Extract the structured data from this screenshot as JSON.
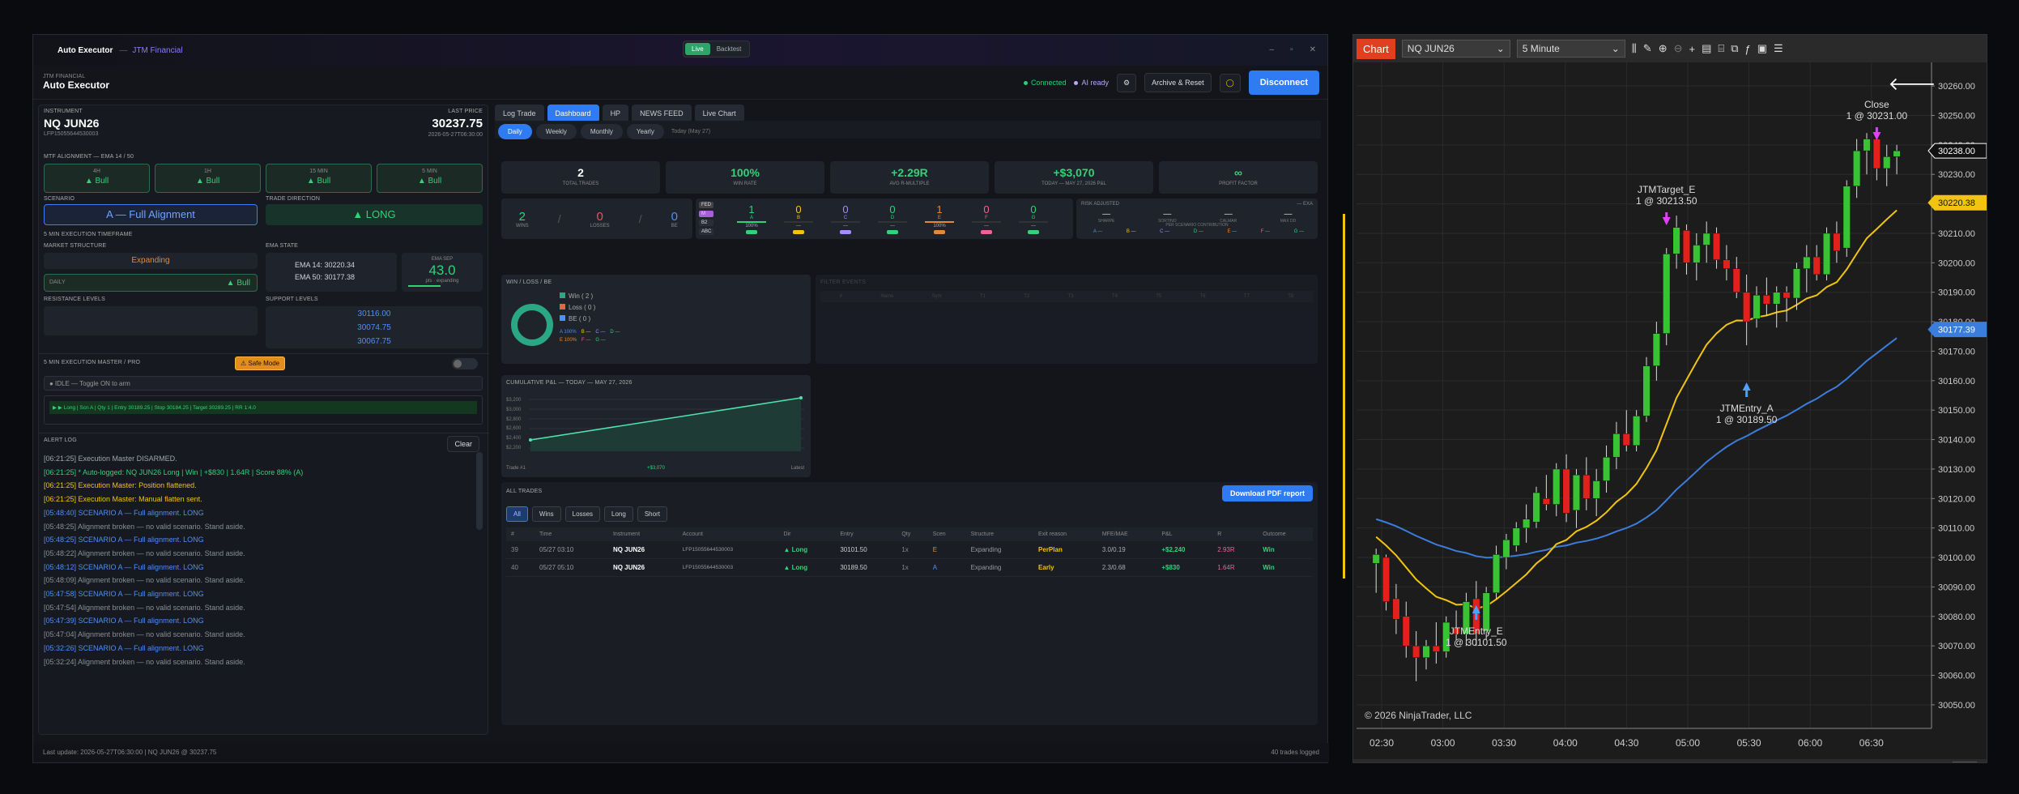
{
  "app": {
    "title": "Auto Executor",
    "separator": "—",
    "subtitle": "JTM Financial",
    "mode_live": "Live",
    "mode_backtest": "Backtest",
    "min": "–",
    "max": "▫",
    "close": "✕"
  },
  "header": {
    "company": "JTM FINANCIAL",
    "title": "Auto Executor",
    "connected": "Connected",
    "ai": "AI ready",
    "settings_icon": "⚙",
    "archive": "Archive & Reset",
    "disconnect": "Disconnect"
  },
  "instrument": {
    "label": "INSTRUMENT",
    "name": "NQ JUN26",
    "account": "LFP15055644530003",
    "last_label": "LAST PRICE",
    "last": "30237.75",
    "time": "2026-05-27T06:30:00"
  },
  "mtf": {
    "label": "MTF ALIGNMENT — EMA 14 / 50",
    "tiles": [
      {
        "tf": "4H",
        "v": "▲ Bull"
      },
      {
        "tf": "1H",
        "v": "▲ Bull"
      },
      {
        "tf": "15 MIN",
        "v": "▲ Bull"
      },
      {
        "tf": "5 MIN",
        "v": "▲ Bull"
      }
    ]
  },
  "scenario": {
    "label": "SCENARIO",
    "value": "A — Full Alignment",
    "dir_label": "TRADE DIRECTION",
    "dir": "▲ LONG"
  },
  "exec": {
    "label": "5 MIN EXECUTION TIMEFRAME",
    "ms_label": "MARKET STRUCTURE",
    "ms": "Expanding",
    "daily": "DAILY",
    "daily_v": "▲ Bull",
    "ema_label": "EMA STATE",
    "ema14": "EMA 14:  30220.34",
    "ema50": "EMA 50:  30177.38",
    "sep_label": "EMA SEP",
    "sep": "43.0",
    "sep_sub": "pts · expanding",
    "res_label": "RESISTANCE LEVELS",
    "sup_label": "SUPPORT LEVELS",
    "supports": [
      "30116.00",
      "30074.75",
      "30067.75"
    ]
  },
  "master": {
    "label": "5 MIN EXECUTION MASTER / PRO",
    "safe": "⚠ Safe Mode",
    "idle": "● IDLE — Toggle ON to arm",
    "signal": "▶ ▶ Long | Scn A | Qty 1 | Entry 30189.25 | Stop 30184.25 | Target 30289.25 | RR 1:4.0"
  },
  "alert": {
    "label": "ALERT LOG",
    "clear": "Clear",
    "lines": [
      {
        "t": "[06:21:25]  Execution Master DISARMED.",
        "c": "#a0a4ad"
      },
      {
        "t": "[06:21:25]  * Auto-logged: NQ JUN26 Long | Win | +$830 | 1.64R | Score 88% (A)",
        "c": "#33d17a"
      },
      {
        "t": "[06:21:25]  Execution Master: Position flattened.",
        "c": "#f1c40f"
      },
      {
        "t": "[06:21:25]  Execution Master: Manual flatten sent.",
        "c": "#f1c40f"
      },
      {
        "t": "[05:48:40]  SCENARIO A — Full alignment. LONG",
        "c": "#4f8ff7"
      },
      {
        "t": "[05:48:25]  Alignment broken — no valid scenario. Stand aside.",
        "c": "#8a8e97"
      },
      {
        "t": "[05:48:25]  SCENARIO A — Full alignment. LONG",
        "c": "#4f8ff7"
      },
      {
        "t": "[05:48:22]  Alignment broken — no valid scenario. Stand aside.",
        "c": "#8a8e97"
      },
      {
        "t": "[05:48:12]  SCENARIO A — Full alignment. LONG",
        "c": "#4f8ff7"
      },
      {
        "t": "[05:48:09]  Alignment broken — no valid scenario. Stand aside.",
        "c": "#8a8e97"
      },
      {
        "t": "[05:47:58]  SCENARIO A — Full alignment. LONG",
        "c": "#4f8ff7"
      },
      {
        "t": "[05:47:54]  Alignment broken — no valid scenario. Stand aside.",
        "c": "#8a8e97"
      },
      {
        "t": "[05:47:39]  SCENARIO A — Full alignment. LONG",
        "c": "#4f8ff7"
      },
      {
        "t": "[05:47:04]  Alignment broken — no valid scenario. Stand aside.",
        "c": "#8a8e97"
      },
      {
        "t": "[05:32:26]  SCENARIO A — Full alignment. LONG",
        "c": "#4f8ff7"
      },
      {
        "t": "[05:32:24]  Alignment broken — no valid scenario. Stand aside.",
        "c": "#8a8e97"
      }
    ]
  },
  "footer": {
    "left": "Last update: 2026-05-27T06:30:00 | NQ JUN26 @ 30237.75",
    "right": "40 trades logged"
  },
  "tabs": [
    "Log Trade",
    "Dashboard",
    "HP",
    "NEWS FEED",
    "Live Chart"
  ],
  "periods": [
    "Daily",
    "Weekly",
    "Monthly",
    "Yearly"
  ],
  "period_note": "Today (May 27)",
  "stats": [
    {
      "v": "2",
      "l": "TOTAL TRADES",
      "c": "#ffffff"
    },
    {
      "v": "100%",
      "l": "WIN RATE",
      "c": "#33d17a"
    },
    {
      "v": "+2.29R",
      "l": "AVG R-MULTIPLE",
      "c": "#33d17a"
    },
    {
      "v": "+$3,070",
      "l": "TODAY — MAY 27, 2026 P&L",
      "c": "#33d17a"
    },
    {
      "v": "∞",
      "l": "PROFIT FACTOR",
      "c": "#33d17a"
    }
  ],
  "wlb": [
    {
      "v": "2",
      "l": "WINS",
      "c": "#33d17a"
    },
    {
      "v": "0",
      "l": "LOSSES",
      "c": "#ef5350"
    },
    {
      "v": "0",
      "l": "BE",
      "c": "#4f8ff7"
    }
  ],
  "scen_tags": [
    "FED",
    "M",
    "B2",
    "ABC"
  ],
  "scen": [
    {
      "n": "1",
      "k": "A",
      "p": "100%",
      "c": "#33d17a"
    },
    {
      "n": "0",
      "k": "B",
      "p": "—",
      "c": "#f1c40f"
    },
    {
      "n": "0",
      "k": "C",
      "p": "—",
      "c": "#a58bff"
    },
    {
      "n": "0",
      "k": "D",
      "p": "—",
      "c": "#33d17a"
    },
    {
      "n": "1",
      "k": "E",
      "p": "100%",
      "c": "#e08a3c"
    },
    {
      "n": "0",
      "k": "F",
      "p": "—",
      "c": "#f06292"
    },
    {
      "n": "0",
      "k": "G",
      "p": "—",
      "c": "#33d17a"
    }
  ],
  "risk": {
    "label": "RISK ADJUSTED",
    "tag": "— EXA",
    "items": [
      "SHARPE",
      "SORTINO",
      "CALMAR",
      "MAX DD"
    ],
    "val": "—",
    "sub": "PER SCENARIO CONTRIBUTION",
    "contrib": [
      "A —",
      "B —",
      "C —",
      "D —",
      "E —",
      "F —",
      "G —"
    ]
  },
  "wlbox": {
    "label": "WIN / LOSS / BE",
    "legend": [
      "Win ( 2 )",
      "Loss ( 0 )",
      "BE ( 0 )"
    ],
    "mini": [
      "A 100%",
      "B —",
      "C —",
      "D —",
      "E 100%",
      "F —",
      "G —"
    ]
  },
  "filter": {
    "label": "FILTER EVENTS",
    "cols": [
      "#",
      "Name",
      "Sym",
      "T1",
      "T2",
      "T3",
      "T4",
      "T5",
      "T6",
      "T7",
      "T8"
    ]
  },
  "cum": {
    "label": "CUMULATIVE P&L — TODAY — MAY 27, 2026",
    "y": [
      "$3,200",
      "$3,000",
      "$2,800",
      "$2,600",
      "$2,400",
      "$2,200"
    ],
    "xl": "Trade #1",
    "xm": "+$3,070",
    "xr": "Latest"
  },
  "trades": {
    "label": "ALL TRADES",
    "download": "Download PDF report",
    "filters": [
      "All",
      "Wins",
      "Losses",
      "Long",
      "Short"
    ],
    "cols": [
      "#",
      "Time",
      "Instrument",
      "Account",
      "Dir",
      "Entry",
      "Qty",
      "Scen",
      "Structure",
      "Exit reason",
      "MFE/MAE",
      "P&L",
      "R",
      "Outcome"
    ],
    "rows": [
      [
        "39",
        "05/27 03:10",
        "NQ JUN26",
        "LFP15055644530003",
        "▲ Long",
        "30101.50",
        "1x",
        "E",
        "Expanding",
        "PerPlan",
        "3.0/0.19",
        "+$2,240",
        "2.93R",
        "Win"
      ],
      [
        "40",
        "05/27 05:10",
        "NQ JUN26",
        "LFP15055644530003",
        "▲ Long",
        "30189.50",
        "1x",
        "A",
        "Expanding",
        "Early",
        "2.3/0.68",
        "+$830",
        "1.64R",
        "Win"
      ]
    ]
  },
  "chartwin": {
    "title": "Chart",
    "instrument": "NQ JUN26",
    "interval": "5 Minute",
    "copyright": "© 2026 NinjaTrader, LLC",
    "back": "🡐"
  },
  "chart_data": {
    "type": "candlestick",
    "instrument": "NQ JUN26",
    "interval": "5 Minute",
    "x": [
      "02:30",
      "03:00",
      "03:30",
      "04:00",
      "04:30",
      "05:00",
      "05:30",
      "06:00",
      "06:30"
    ],
    "yticks": [
      "30260.00",
      "30250.00",
      "30240.00",
      "30230.00",
      "30220.00",
      "30210.00",
      "30200.00",
      "30190.00",
      "30180.00",
      "30170.00",
      "30160.00",
      "30150.00",
      "30140.00",
      "30130.00",
      "30120.00",
      "30110.00",
      "30100.00",
      "30090.00",
      "30080.00",
      "30070.00",
      "30060.00",
      "30050.00"
    ],
    "ylim": [
      30042,
      30268
    ],
    "price_labels": [
      {
        "v": "30238.00",
        "c": "#111111"
      },
      {
        "v": "30220.38",
        "c": "#f1c40f"
      },
      {
        "v": "30177.39",
        "c": "#3b7ddd"
      }
    ],
    "annotations": [
      {
        "l1": "Close",
        "l2": "1 @ 30231.00"
      },
      {
        "l1": "JTMTarget_E",
        "l2": "1 @ 30213.50"
      },
      {
        "l1": "JTMEntry_A",
        "l2": "1 @ 30189.50"
      },
      {
        "l1": "JTMEntry_E",
        "l2": "1 @ 30101.50"
      }
    ],
    "series": [
      {
        "name": "EMA 14",
        "color": "#f1c40f"
      },
      {
        "name": "EMA 50",
        "color": "#3b7ddd"
      }
    ],
    "candles": [
      [
        30098,
        30103,
        30088,
        30101
      ],
      [
        30100,
        30101,
        30082,
        30085
      ],
      [
        30086,
        30091,
        30074,
        30079
      ],
      [
        30080,
        30085,
        30066,
        30070
      ],
      [
        30070,
        30075,
        30058,
        30066
      ],
      [
        30066,
        30072,
        30062,
        30070
      ],
      [
        30070,
        30078,
        30064,
        30068
      ],
      [
        30068,
        30080,
        30066,
        30078
      ],
      [
        30076,
        30082,
        30072,
        30074
      ],
      [
        30074,
        30088,
        30070,
        30085
      ],
      [
        30086,
        30092,
        30070,
        30074
      ],
      [
        30075,
        30090,
        30072,
        30088
      ],
      [
        30088,
        30104,
        30086,
        30101
      ],
      [
        30100,
        30108,
        30096,
        30106
      ],
      [
        30104,
        30112,
        30102,
        30110
      ],
      [
        30110,
        30118,
        30105,
        30113
      ],
      [
        30112,
        30124,
        30110,
        30122
      ],
      [
        30120,
        30128,
        30116,
        30118
      ],
      [
        30118,
        30132,
        30114,
        30130
      ],
      [
        30130,
        30135,
        30112,
        30115
      ],
      [
        30116,
        30130,
        30110,
        30128
      ],
      [
        30128,
        30134,
        30116,
        30120
      ],
      [
        30120,
        30130,
        30114,
        30126
      ],
      [
        30126,
        30138,
        30122,
        30134
      ],
      [
        30134,
        30146,
        30130,
        30142
      ],
      [
        30142,
        30150,
        30136,
        30138
      ],
      [
        30138,
        30150,
        30136,
        30148
      ],
      [
        30148,
        30168,
        30146,
        30165
      ],
      [
        30165,
        30180,
        30160,
        30176
      ],
      [
        30176,
        30205,
        30172,
        30203
      ],
      [
        30203,
        30216,
        30198,
        30212
      ],
      [
        30211,
        30213,
        30196,
        30200
      ],
      [
        30200,
        30210,
        30194,
        30206
      ],
      [
        30206,
        30214,
        30200,
        30210
      ],
      [
        30210,
        30212,
        30198,
        30201
      ],
      [
        30201,
        30206,
        30194,
        30198
      ],
      [
        30198,
        30202,
        30188,
        30190
      ],
      [
        30190,
        30196,
        30172,
        30180
      ],
      [
        30181,
        30192,
        30178,
        30189
      ],
      [
        30189,
        30195,
        30182,
        30186
      ],
      [
        30186,
        30192,
        30178,
        30190
      ],
      [
        30190,
        30192,
        30180,
        30188
      ],
      [
        30188,
        30200,
        30184,
        30198
      ],
      [
        30198,
        30206,
        30190,
        30202
      ],
      [
        30202,
        30206,
        30194,
        30196
      ],
      [
        30196,
        30212,
        30194,
        30210
      ],
      [
        30210,
        30214,
        30200,
        30204
      ],
      [
        30205,
        30228,
        30202,
        30226
      ],
      [
        30226,
        30242,
        30222,
        30238
      ],
      [
        30238,
        30244,
        30230,
        30242
      ],
      [
        30242,
        30244,
        30228,
        30232
      ],
      [
        30232,
        30240,
        30226,
        30236
      ],
      [
        30236,
        30240,
        30230,
        30238
      ]
    ]
  }
}
